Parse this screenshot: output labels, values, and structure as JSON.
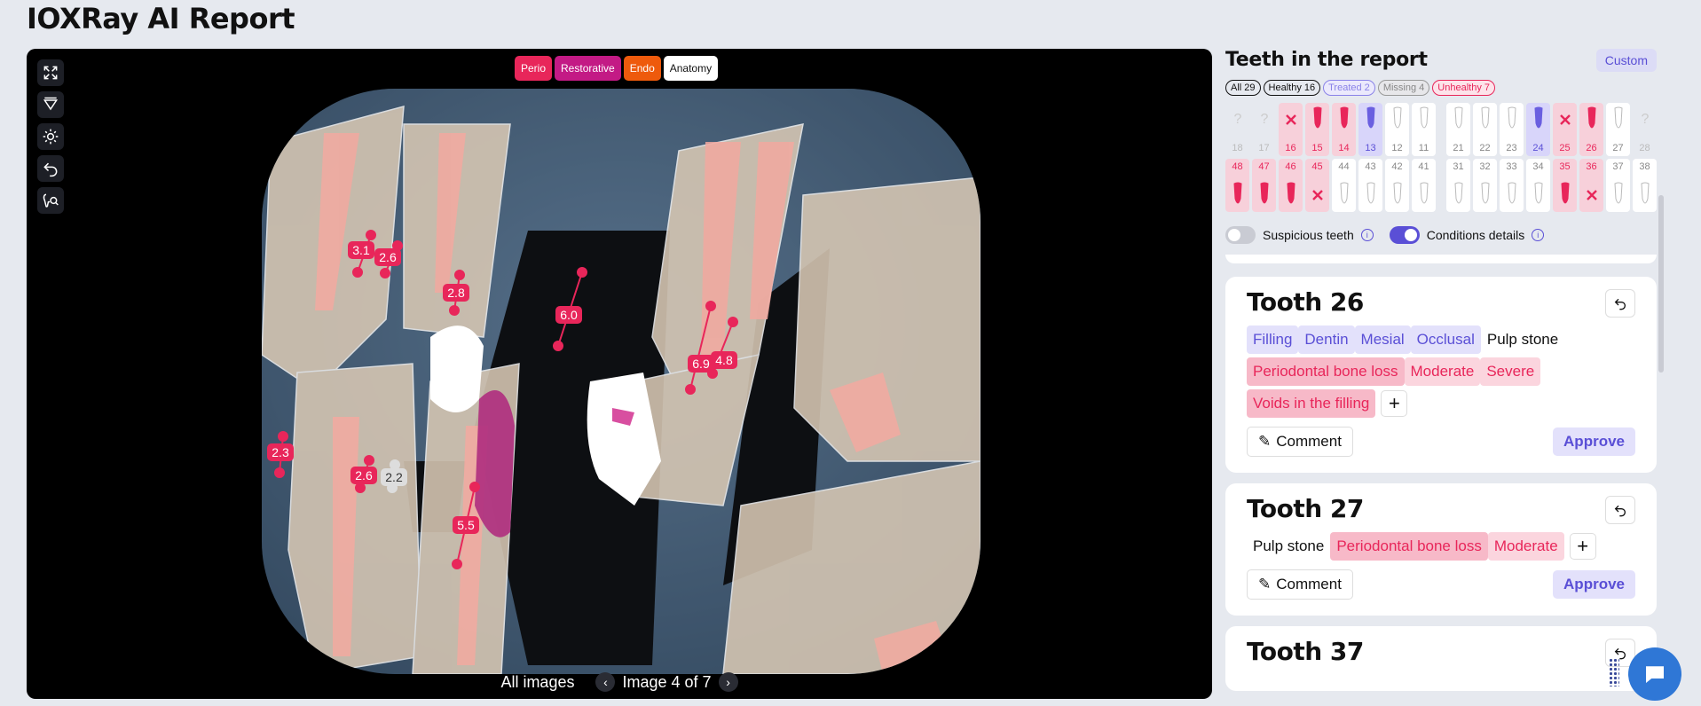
{
  "page": {
    "title": "IOXRay AI Report"
  },
  "viewer": {
    "filters": [
      "Perio",
      "Restorative",
      "Endo",
      "Anatomy"
    ],
    "tools": [
      "expand-icon",
      "filter-icon",
      "brightness-icon",
      "undo-icon",
      "tooth-magnify-icon"
    ],
    "footer": {
      "all_images": "All images",
      "image_label": "Image 4 of 7"
    },
    "measurements": [
      "3.1",
      "2.6",
      "2.8",
      "6.0",
      "6.9",
      "4.8",
      "2.3",
      "2.6",
      "2.2",
      "5.5"
    ]
  },
  "panel": {
    "title": "Teeth in the report",
    "custom": "Custom",
    "chips": [
      "All 29",
      "Healthy 16",
      "Treated 2",
      "Missing 4",
      "Unhealthy 7"
    ],
    "upper": [
      {
        "n": "18",
        "s": "missing"
      },
      {
        "n": "17",
        "s": "missing"
      },
      {
        "n": "16",
        "s": "unhealthy-x"
      },
      {
        "n": "15",
        "s": "unhealthy"
      },
      {
        "n": "14",
        "s": "unhealthy"
      },
      {
        "n": "13",
        "s": "treated"
      },
      {
        "n": "12",
        "s": "healthy"
      },
      {
        "n": "11",
        "s": "healthy"
      },
      {
        "n": "21",
        "s": "healthy"
      },
      {
        "n": "22",
        "s": "healthy"
      },
      {
        "n": "23",
        "s": "healthy"
      },
      {
        "n": "24",
        "s": "treated"
      },
      {
        "n": "25",
        "s": "unhealthy-x"
      },
      {
        "n": "26",
        "s": "unhealthy"
      },
      {
        "n": "27",
        "s": "healthy"
      },
      {
        "n": "28",
        "s": "missing"
      }
    ],
    "lower": [
      {
        "n": "48",
        "s": "unhealthy"
      },
      {
        "n": "47",
        "s": "unhealthy"
      },
      {
        "n": "46",
        "s": "unhealthy"
      },
      {
        "n": "45",
        "s": "unhealthy-x"
      },
      {
        "n": "44",
        "s": "healthy"
      },
      {
        "n": "43",
        "s": "healthy"
      },
      {
        "n": "42",
        "s": "healthy"
      },
      {
        "n": "41",
        "s": "healthy"
      },
      {
        "n": "31",
        "s": "healthy"
      },
      {
        "n": "32",
        "s": "healthy"
      },
      {
        "n": "33",
        "s": "healthy"
      },
      {
        "n": "34",
        "s": "healthy"
      },
      {
        "n": "35",
        "s": "unhealthy"
      },
      {
        "n": "36",
        "s": "unhealthy-x"
      },
      {
        "n": "37",
        "s": "healthy"
      },
      {
        "n": "38",
        "s": "healthy"
      }
    ],
    "toggles": {
      "suspicious": "Suspicious teeth",
      "conditions": "Conditions details"
    },
    "cards": [
      {
        "title": "Tooth 26",
        "tags": [
          {
            "label": "Filling",
            "c": "t-blue"
          },
          {
            "label": "Dentin",
            "c": "t-blue"
          },
          {
            "label": "Mesial",
            "c": "t-blue"
          },
          {
            "label": "Occlusal",
            "c": "t-blue"
          },
          {
            "label": "Pulp stone",
            "c": "t-plain"
          },
          {
            "label": "Periodontal bone loss",
            "c": "t-red-strong"
          },
          {
            "label": "Moderate",
            "c": "t-red"
          },
          {
            "label": "Severe",
            "c": "t-red"
          },
          {
            "label": "Voids in the filling",
            "c": "t-red-strong"
          }
        ],
        "comment": "Comment",
        "approve": "Approve"
      },
      {
        "title": "Tooth 27",
        "tags": [
          {
            "label": "Pulp stone",
            "c": "t-plain"
          },
          {
            "label": "Periodontal bone loss",
            "c": "t-red-strong"
          },
          {
            "label": "Moderate",
            "c": "t-red"
          }
        ],
        "comment": "Comment",
        "approve": "Approve"
      },
      {
        "title": "Tooth 37"
      }
    ]
  },
  "colors": {
    "accent": "#5a4fd6",
    "perio": "#e8265a",
    "restorative": "#c31a85",
    "endo": "#ee5a0c"
  }
}
